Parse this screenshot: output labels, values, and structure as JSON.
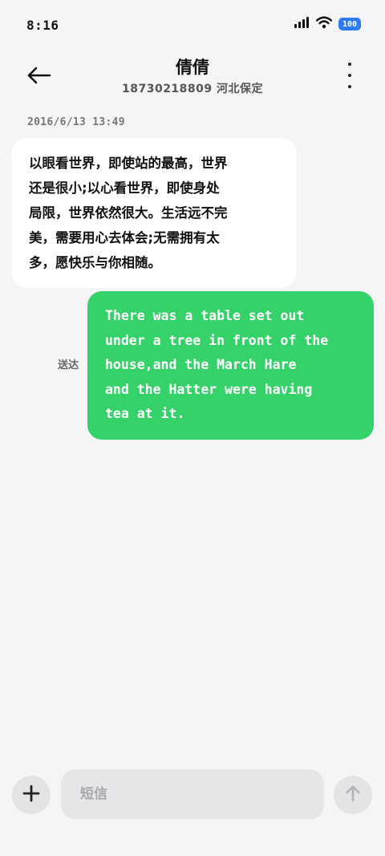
{
  "status_bar": {
    "time": "8:16",
    "battery": "100",
    "icons": [
      "signal-icon",
      "wifi-icon",
      "battery-icon"
    ]
  },
  "header": {
    "back_icon": "back-arrow-icon",
    "contact_name": "倩倩",
    "contact_sub": "18730218809 河北保定",
    "more_icon": "more-vertical-icon"
  },
  "conversation": {
    "timestamp": "2016/6/13 13:49",
    "incoming_lines": [
      "以眼看世界，即使站的最高，世界",
      "还是很小;以心看世界，即使身处",
      "局限，世界依然很大。生活远不完",
      "美，需要用心去体会;无需拥有太",
      "多，愿快乐与你相随。"
    ],
    "sent_label": "送达",
    "outgoing_lines": [
      "There was a table set out",
      "under a tree in front of the",
      "house,and the March Hare",
      "and the Hatter were having",
      "tea at it."
    ]
  },
  "input_bar": {
    "plus_icon": "plus-icon",
    "placeholder": "短信",
    "send_icon": "send-arrow-up-icon"
  },
  "colors": {
    "background": "#f5f5f7",
    "incoming_bubble": "#ffffff",
    "outgoing_bubble": "#35d26a",
    "battery": "#2d7cf6"
  }
}
